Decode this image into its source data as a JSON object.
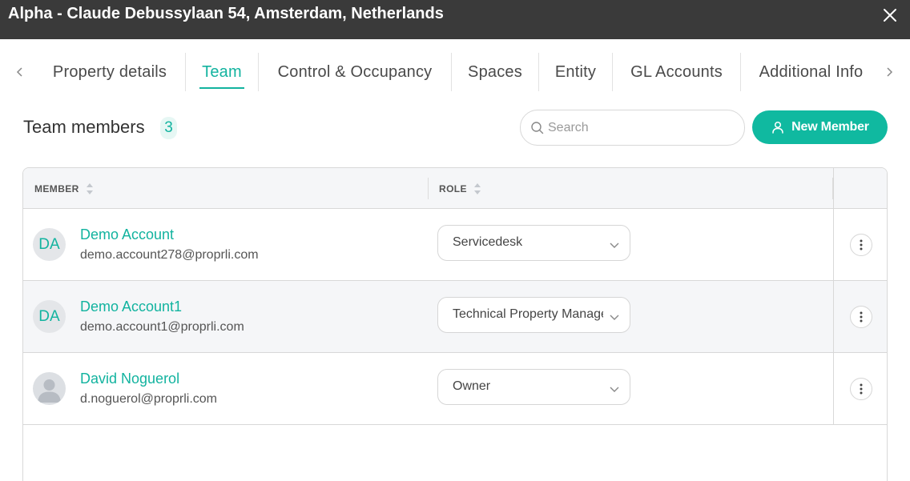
{
  "window": {
    "title": "Alpha - Claude Debussylaan 54, Amsterdam, Netherlands",
    "close_icon": "close-icon"
  },
  "tabs": [
    {
      "label": "Property details",
      "active": false
    },
    {
      "label": "Team",
      "active": true
    },
    {
      "label": "Control & Occupancy",
      "active": false
    },
    {
      "label": "Spaces",
      "active": false
    },
    {
      "label": "Entity",
      "active": false
    },
    {
      "label": "GL Accounts",
      "active": false
    },
    {
      "label": "Additional Info",
      "active": false
    }
  ],
  "section": {
    "title": "Team members",
    "count": "3"
  },
  "search": {
    "placeholder": "Search",
    "value": ""
  },
  "new_member_button": {
    "label": "New Member"
  },
  "table": {
    "columns": [
      "MEMBER",
      "ROLE"
    ],
    "rows": [
      {
        "initials": "DA",
        "name": "Demo Account",
        "email": "demo.account278@proprli.com",
        "role": "Servicedesk",
        "avatar": "initials"
      },
      {
        "initials": "DA",
        "name": "Demo Account1",
        "email": "demo.account1@proprli.com",
        "role": "Technical Property Manager",
        "avatar": "initials"
      },
      {
        "initials": "",
        "name": "David Noguerol",
        "email": "d.noguerol@proprli.com",
        "role": "Owner",
        "avatar": "photo-placeholder"
      }
    ]
  },
  "colors": {
    "accent": "#12b39f",
    "button": "#10b9a0",
    "titlebar": "#3a3a3a",
    "row_alt": "#f5f6f8"
  }
}
